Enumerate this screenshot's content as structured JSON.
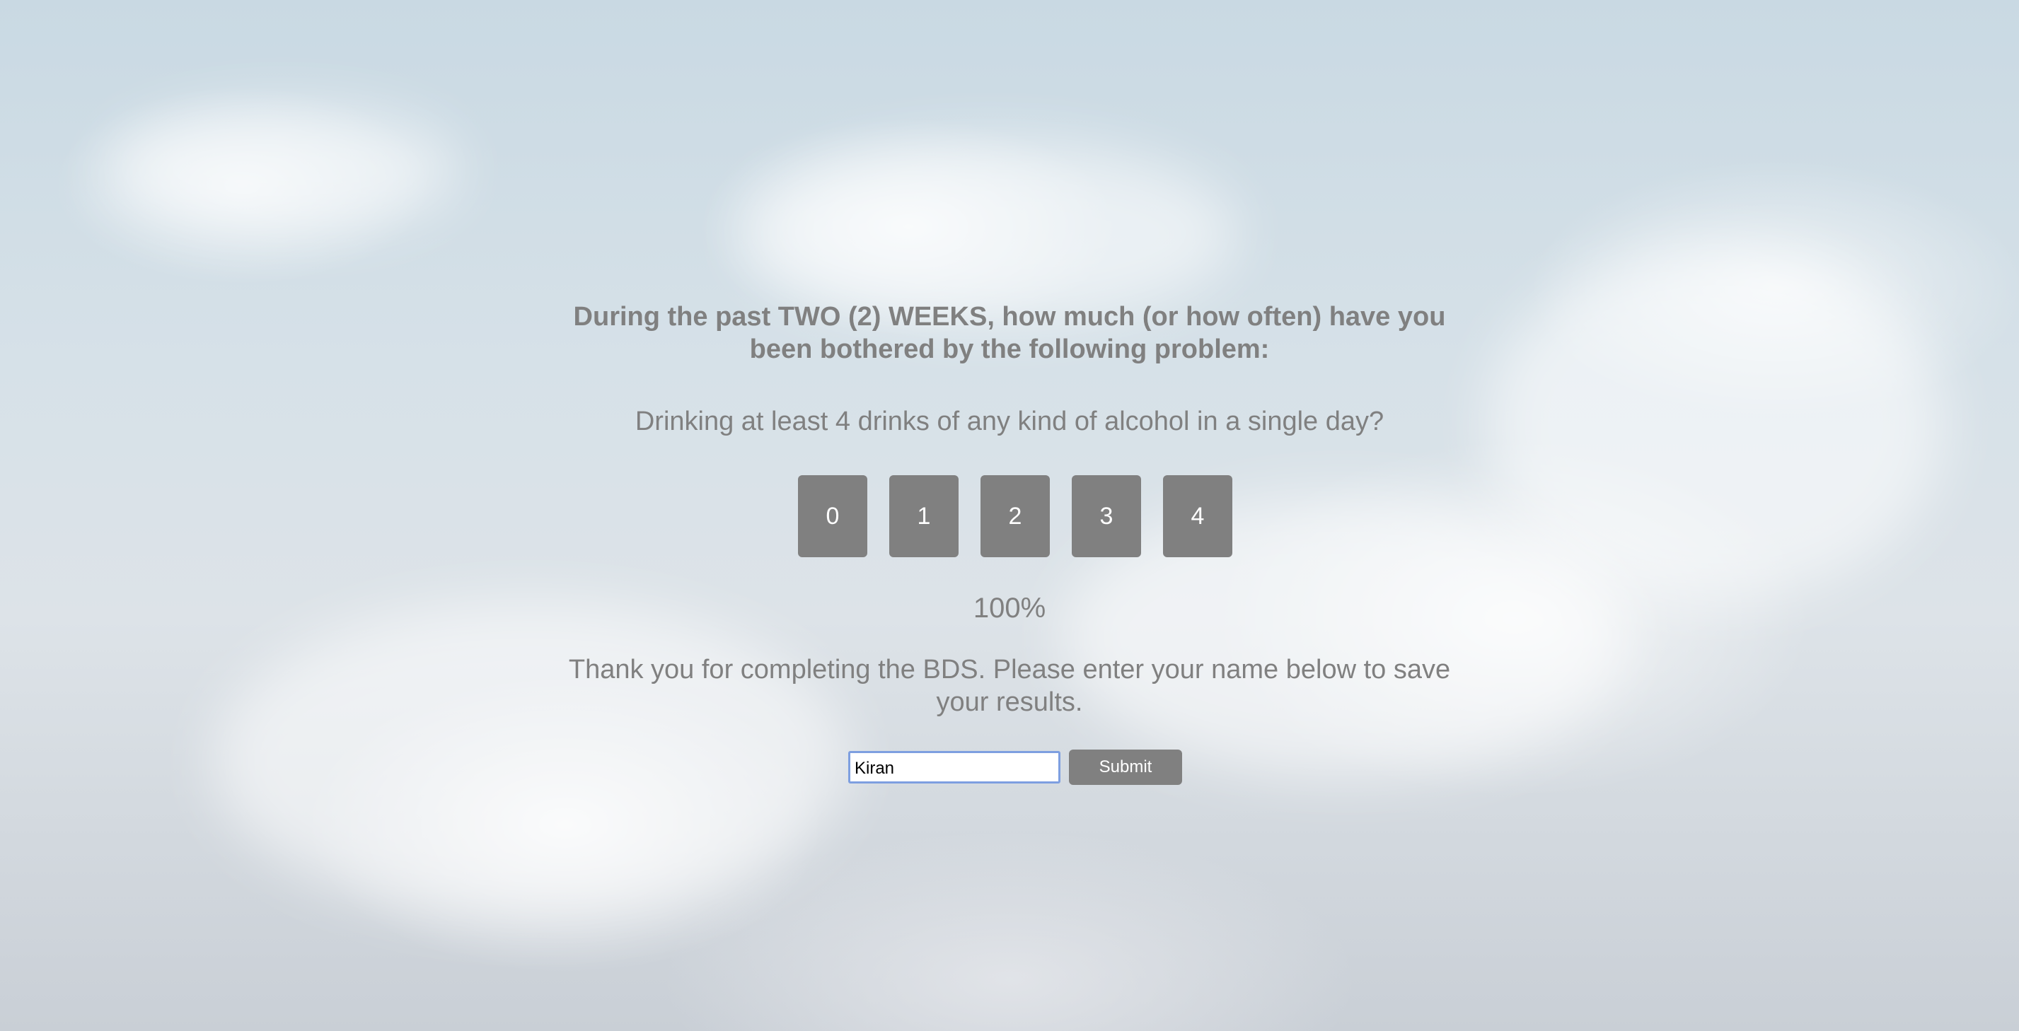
{
  "survey": {
    "heading": "During the past TWO (2) WEEKS, how much (or how often) have you been bothered by the following problem:",
    "question": "Drinking at least 4 drinks of any kind of alcohol in a single day?",
    "options": [
      "0",
      "1",
      "2",
      "3",
      "4"
    ],
    "progress_text": "100%",
    "progress_value": 1.0
  },
  "completion": {
    "message": "Thank you for completing the BDS. Please enter your name below to save your results.",
    "name_value": "Kiran",
    "submit_label": "Submit"
  },
  "colors": {
    "text": "#808080",
    "button_bg": "#808080",
    "button_text": "#ffffff",
    "input_focus_border": "#7e9fe0"
  }
}
